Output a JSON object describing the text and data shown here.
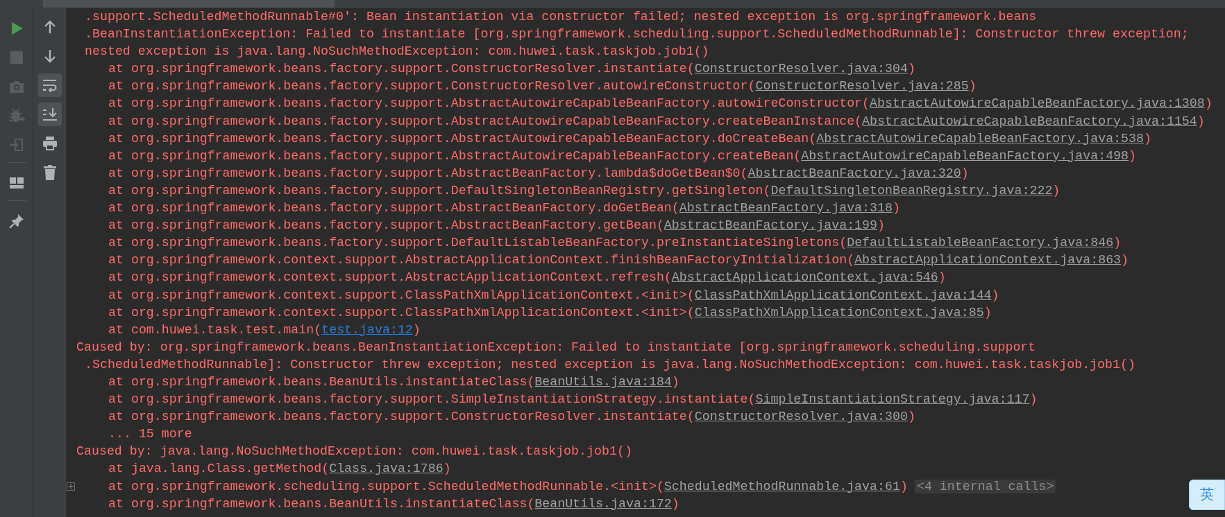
{
  "left_toolbar": [
    {
      "kind": "run",
      "disabled": false
    },
    {
      "kind": "stop",
      "disabled": true
    },
    {
      "kind": "camera",
      "disabled": true
    },
    {
      "kind": "bug",
      "disabled": true
    },
    {
      "kind": "exit",
      "disabled": true
    },
    {
      "kind": "sep"
    },
    {
      "kind": "layout",
      "disabled": false
    },
    {
      "kind": "sep"
    },
    {
      "kind": "pin",
      "disabled": false
    }
  ],
  "console_toolbar": [
    {
      "kind": "up",
      "selected": false
    },
    {
      "kind": "down",
      "selected": false
    },
    {
      "kind": "wrap",
      "selected": true
    },
    {
      "kind": "scroll",
      "selected": true
    },
    {
      "kind": "print",
      "selected": false
    },
    {
      "kind": "trash",
      "selected": false
    }
  ],
  "console_lines": [
    {
      "kind": "continuation",
      "text": ".support.ScheduledMethodRunnable#0': Bean instantiation via constructor failed; nested exception is org.springframework.beans"
    },
    {
      "kind": "continuation",
      "text": ".BeanInstantiationException: Failed to instantiate [org.springframework.scheduling.support.ScheduledMethodRunnable]: Constructor threw exception;"
    },
    {
      "kind": "continuation",
      "text": "nested exception is java.lang.NoSuchMethodException: com.huwei.task.taskjob.job1()"
    },
    {
      "kind": "frame",
      "text": "at org.springframework.beans.factory.support.ConstructorResolver.instantiate(",
      "link": "ConstructorResolver.java:304",
      "tail": ")",
      "project": false,
      "foldable": false
    },
    {
      "kind": "frame",
      "text": "at org.springframework.beans.factory.support.ConstructorResolver.autowireConstructor(",
      "link": "ConstructorResolver.java:285",
      "tail": ")",
      "project": false,
      "foldable": false
    },
    {
      "kind": "frame",
      "text": "at org.springframework.beans.factory.support.AbstractAutowireCapableBeanFactory.autowireConstructor(",
      "link": "AbstractAutowireCapableBeanFactory.java:1308",
      "tail": ")",
      "project": false,
      "foldable": false
    },
    {
      "kind": "frame",
      "text": "at org.springframework.beans.factory.support.AbstractAutowireCapableBeanFactory.createBeanInstance(",
      "link": "AbstractAutowireCapableBeanFactory.java:1154",
      "tail": ")",
      "project": false,
      "foldable": false
    },
    {
      "kind": "frame",
      "text": "at org.springframework.beans.factory.support.AbstractAutowireCapableBeanFactory.doCreateBean(",
      "link": "AbstractAutowireCapableBeanFactory.java:538",
      "tail": ")",
      "project": false,
      "foldable": false
    },
    {
      "kind": "frame",
      "text": "at org.springframework.beans.factory.support.AbstractAutowireCapableBeanFactory.createBean(",
      "link": "AbstractAutowireCapableBeanFactory.java:498",
      "tail": ")",
      "project": false,
      "foldable": false
    },
    {
      "kind": "frame",
      "text": "at org.springframework.beans.factory.support.AbstractBeanFactory.lambda$doGetBean$0(",
      "link": "AbstractBeanFactory.java:320",
      "tail": ")",
      "project": false,
      "foldable": false
    },
    {
      "kind": "frame",
      "text": "at org.springframework.beans.factory.support.DefaultSingletonBeanRegistry.getSingleton(",
      "link": "DefaultSingletonBeanRegistry.java:222",
      "tail": ")",
      "project": false,
      "foldable": false
    },
    {
      "kind": "frame",
      "text": "at org.springframework.beans.factory.support.AbstractBeanFactory.doGetBean(",
      "link": "AbstractBeanFactory.java:318",
      "tail": ")",
      "project": false,
      "foldable": false
    },
    {
      "kind": "frame",
      "text": "at org.springframework.beans.factory.support.AbstractBeanFactory.getBean(",
      "link": "AbstractBeanFactory.java:199",
      "tail": ")",
      "project": false,
      "foldable": false
    },
    {
      "kind": "frame",
      "text": "at org.springframework.beans.factory.support.DefaultListableBeanFactory.preInstantiateSingletons(",
      "link": "DefaultListableBeanFactory.java:846",
      "tail": ")",
      "project": false,
      "foldable": false
    },
    {
      "kind": "frame",
      "text": "at org.springframework.context.support.AbstractApplicationContext.finishBeanFactoryInitialization(",
      "link": "AbstractApplicationContext.java:863",
      "tail": ")",
      "project": false,
      "foldable": false
    },
    {
      "kind": "frame",
      "text": "at org.springframework.context.support.AbstractApplicationContext.refresh(",
      "link": "AbstractApplicationContext.java:546",
      "tail": ")",
      "project": false,
      "foldable": false
    },
    {
      "kind": "frame",
      "text": "at org.springframework.context.support.ClassPathXmlApplicationContext.<init>(",
      "link": "ClassPathXmlApplicationContext.java:144",
      "tail": ")",
      "project": false,
      "foldable": false
    },
    {
      "kind": "frame",
      "text": "at org.springframework.context.support.ClassPathXmlApplicationContext.<init>(",
      "link": "ClassPathXmlApplicationContext.java:85",
      "tail": ")",
      "project": false,
      "foldable": false
    },
    {
      "kind": "frame",
      "text": "at com.huwei.task.test.main(",
      "link": "test.java:12",
      "tail": ")",
      "project": true,
      "foldable": false
    },
    {
      "kind": "message",
      "text": "Caused by: org.springframework.beans.BeanInstantiationException: Failed to instantiate [org.springframework.scheduling.support"
    },
    {
      "kind": "continuation",
      "text": ".ScheduledMethodRunnable]: Constructor threw exception; nested exception is java.lang.NoSuchMethodException: com.huwei.task.taskjob.job1()"
    },
    {
      "kind": "frame",
      "text": "at org.springframework.beans.BeanUtils.instantiateClass(",
      "link": "BeanUtils.java:184",
      "tail": ")",
      "project": false,
      "foldable": false
    },
    {
      "kind": "frame",
      "text": "at org.springframework.beans.factory.support.SimpleInstantiationStrategy.instantiate(",
      "link": "SimpleInstantiationStrategy.java:117",
      "tail": ")",
      "project": false,
      "foldable": false
    },
    {
      "kind": "frame",
      "text": "at org.springframework.beans.factory.support.ConstructorResolver.instantiate(",
      "link": "ConstructorResolver.java:300",
      "tail": ")",
      "project": false,
      "foldable": false
    },
    {
      "kind": "more",
      "text": "... 15 more"
    },
    {
      "kind": "message",
      "text": "Caused by: java.lang.NoSuchMethodException: com.huwei.task.taskjob.job1()"
    },
    {
      "kind": "frame",
      "text": "at java.lang.Class.getMethod(",
      "link": "Class.java:1786",
      "tail": ")",
      "project": false,
      "foldable": false
    },
    {
      "kind": "frame",
      "text": "at org.springframework.scheduling.support.ScheduledMethodRunnable.<init>(",
      "link": "ScheduledMethodRunnable.java:61",
      "tail": ")",
      "project": false,
      "foldable": true,
      "folded": "<4 internal calls>"
    },
    {
      "kind": "frame",
      "text": "at org.springframework.beans.BeanUtils.instantiateClass(",
      "link": "BeanUtils.java:172",
      "tail": ")",
      "project": false,
      "foldable": false
    }
  ],
  "ime_indicator": {
    "label": "英"
  }
}
